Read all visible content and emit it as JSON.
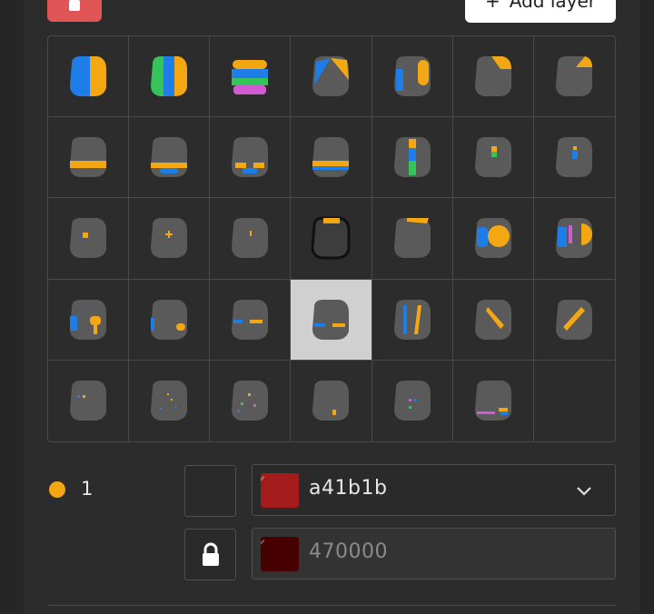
{
  "toolbar": {
    "delete_icon": "trash-icon",
    "add_layer_label": "Add layer",
    "add_layer_icon": "plus-icon"
  },
  "grid": {
    "selected_index": 24,
    "item_count": 34
  },
  "layer": {
    "dot_color": "#f3a712",
    "number": "1",
    "lock_icon": "lock-icon",
    "primary_color": {
      "hex": "a41b1b",
      "swatch": "#a41b1b",
      "dropdown_icon": "chevron-down-icon"
    },
    "secondary_color": {
      "hex": "470000",
      "swatch": "#470000"
    }
  },
  "colors": {
    "accent_orange": "#f3a712",
    "accent_blue": "#1e7de6",
    "accent_green": "#34c45a",
    "accent_pink": "#d25ad2",
    "shape_gray": "#5a5a5a"
  }
}
